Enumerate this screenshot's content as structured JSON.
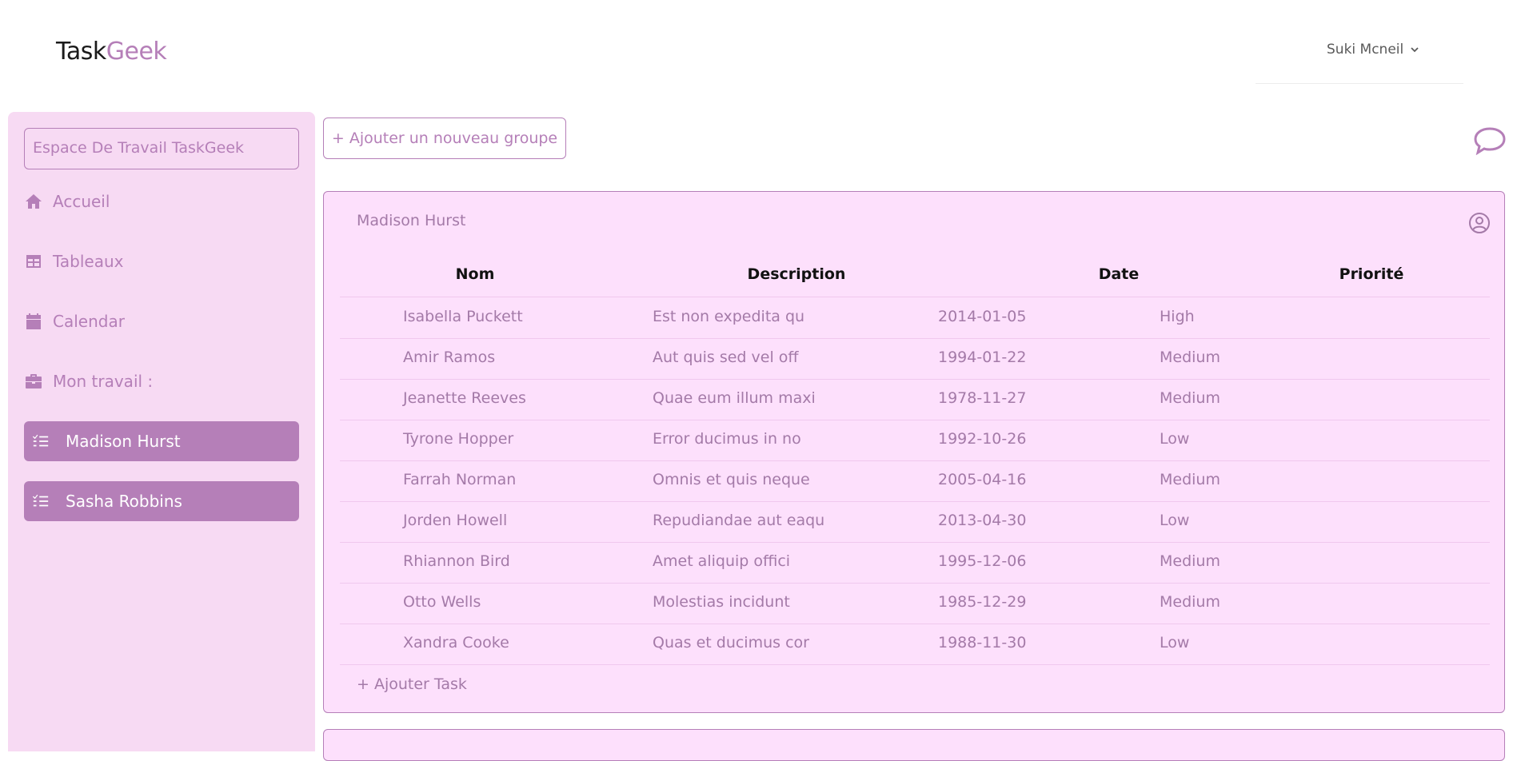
{
  "app": {
    "logo_main": "Task",
    "logo_accent": "Geek"
  },
  "user": {
    "name": "Suki Mcneil"
  },
  "sidebar": {
    "workspace": "Espace De Travail TaskGeek",
    "nav": [
      {
        "label": "Accueil",
        "icon": "home-icon"
      },
      {
        "label": "Tableaux",
        "icon": "table-icon"
      },
      {
        "label": "Calendar",
        "icon": "calendar-icon"
      },
      {
        "label": "Mon travail :",
        "icon": "briefcase-icon"
      }
    ],
    "boards": [
      {
        "label": "Madison Hurst",
        "icon": "task-list-icon"
      },
      {
        "label": "Sasha Robbins",
        "icon": "task-list-icon"
      }
    ]
  },
  "main": {
    "add_group_label": "+ Ajouter un nouveau groupe",
    "group": {
      "title": "Madison Hurst",
      "columns": [
        "Nom",
        "Description",
        "Date",
        "Priorité"
      ],
      "rows": [
        [
          "Isabella Puckett",
          "Est non expedita qu",
          "2014-01-05",
          "High"
        ],
        [
          "Amir Ramos",
          "Aut quis sed vel off",
          "1994-01-22",
          "Medium"
        ],
        [
          "Jeanette Reeves",
          "Quae eum illum maxi",
          "1978-11-27",
          "Medium"
        ],
        [
          "Tyrone Hopper",
          "Error ducimus in no",
          "1992-10-26",
          "Low"
        ],
        [
          "Farrah Norman",
          "Omnis et quis neque",
          "2005-04-16",
          "Medium"
        ],
        [
          "Jorden Howell",
          "Repudiandae aut eaqu",
          "2013-04-30",
          "Low"
        ],
        [
          "Rhiannon Bird",
          "Amet aliquip offici",
          "1995-12-06",
          "Medium"
        ],
        [
          "Otto Wells",
          "Molestias incidunt",
          "1985-12-29",
          "Medium"
        ],
        [
          "Xandra Cooke",
          "Quas et ducimus cor",
          "1988-11-30",
          "Low"
        ]
      ],
      "add_task_label": "+ Ajouter Task"
    }
  },
  "colors": {
    "accent": "#b57fb8",
    "sidebar_bg": "#f7daf3",
    "group_bg": "#fde0fc"
  }
}
